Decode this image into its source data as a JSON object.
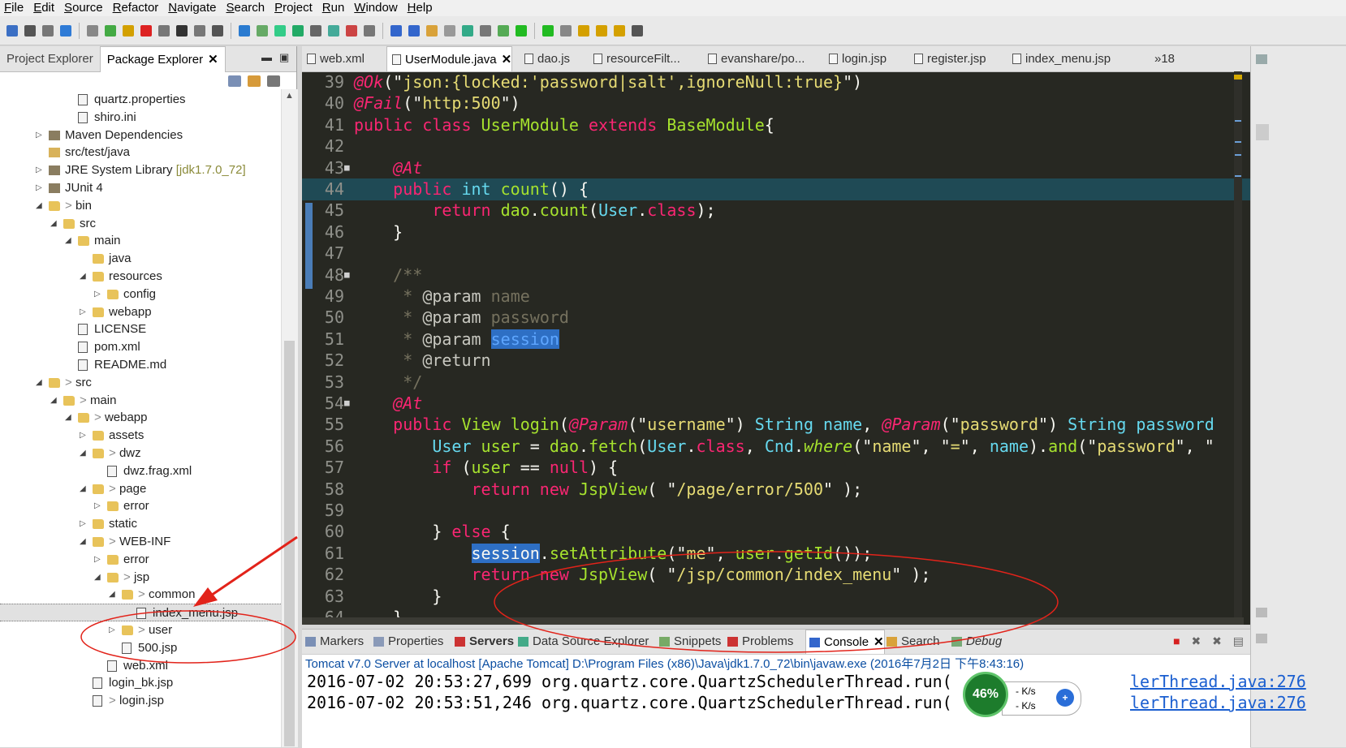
{
  "menu": [
    "File",
    "Edit",
    "Source",
    "Refactor",
    "Navigate",
    "Search",
    "Project",
    "Run",
    "Window",
    "Help"
  ],
  "left_panel": {
    "tabs": [
      {
        "label": "Project Explorer",
        "active": false
      },
      {
        "label": "Package Explorer",
        "active": true,
        "close": "✕"
      }
    ],
    "tree": [
      {
        "label": "quartz.properties",
        "indent": 3,
        "icon": "file-icon",
        "twisty": ""
      },
      {
        "label": "shiro.ini",
        "indent": 3,
        "icon": "file-icon",
        "twisty": ""
      },
      {
        "label": "Maven Dependencies",
        "indent": 1,
        "icon": "library-icon",
        "twisty": "▷"
      },
      {
        "label": "src/test/java",
        "indent": 1,
        "icon": "source-folder-icon",
        "twisty": ""
      },
      {
        "label": "JRE System Library",
        "suffix": "[jdk1.7.0_72]",
        "indent": 1,
        "icon": "library-icon",
        "twisty": "▷"
      },
      {
        "label": "JUnit 4",
        "indent": 1,
        "icon": "library-icon",
        "twisty": "▷"
      },
      {
        "label": "bin",
        "prefix": "> ",
        "indent": 1,
        "icon": "folder-icon",
        "twisty": "◢"
      },
      {
        "label": "src",
        "indent": 2,
        "icon": "folder-icon",
        "twisty": "◢"
      },
      {
        "label": "main",
        "indent": 3,
        "icon": "folder-icon",
        "twisty": "◢"
      },
      {
        "label": "java",
        "indent": 4,
        "icon": "folder-icon",
        "twisty": ""
      },
      {
        "label": "resources",
        "indent": 4,
        "icon": "folder-icon",
        "twisty": "◢"
      },
      {
        "label": "config",
        "indent": 5,
        "icon": "folder-icon",
        "twisty": "▷"
      },
      {
        "label": "webapp",
        "indent": 4,
        "icon": "folder-icon",
        "twisty": "▷"
      },
      {
        "label": "LICENSE",
        "indent": 3,
        "icon": "file-icon",
        "twisty": ""
      },
      {
        "label": "pom.xml",
        "indent": 3,
        "icon": "xml-file-icon",
        "twisty": ""
      },
      {
        "label": "README.md",
        "indent": 3,
        "icon": "file-icon",
        "twisty": ""
      },
      {
        "label": "src",
        "prefix": "> ",
        "indent": 1,
        "icon": "folder-icon",
        "twisty": "◢"
      },
      {
        "label": "main",
        "prefix": "> ",
        "indent": 2,
        "icon": "folder-icon",
        "twisty": "◢"
      },
      {
        "label": "webapp",
        "prefix": "> ",
        "indent": 3,
        "icon": "folder-icon",
        "twisty": "◢"
      },
      {
        "label": "assets",
        "indent": 4,
        "icon": "folder-icon",
        "twisty": "▷"
      },
      {
        "label": "dwz",
        "prefix": "> ",
        "indent": 4,
        "icon": "folder-icon",
        "twisty": "◢"
      },
      {
        "label": "dwz.frag.xml",
        "indent": 5,
        "icon": "xml-file-icon",
        "twisty": ""
      },
      {
        "label": "page",
        "prefix": "> ",
        "indent": 4,
        "icon": "folder-icon",
        "twisty": "◢"
      },
      {
        "label": "error",
        "indent": 5,
        "icon": "folder-icon",
        "twisty": "▷"
      },
      {
        "label": "static",
        "indent": 4,
        "icon": "folder-icon",
        "twisty": "▷"
      },
      {
        "label": "WEB-INF",
        "prefix": "> ",
        "indent": 4,
        "icon": "folder-icon",
        "twisty": "◢"
      },
      {
        "label": "error",
        "indent": 5,
        "icon": "folder-icon",
        "twisty": "▷"
      },
      {
        "label": "jsp",
        "prefix": "> ",
        "indent": 5,
        "icon": "folder-icon",
        "twisty": "◢"
      },
      {
        "label": "common",
        "prefix": "> ",
        "indent": 6,
        "icon": "folder-icon",
        "twisty": "◢"
      },
      {
        "label": "index_menu.jsp",
        "indent": 7,
        "icon": "jsp-file-icon",
        "twisty": "",
        "selected": true
      },
      {
        "label": "user",
        "prefix": "> ",
        "indent": 6,
        "icon": "folder-icon",
        "twisty": "▷"
      },
      {
        "label": "500.jsp",
        "indent": 6,
        "icon": "jsp-file-icon",
        "twisty": ""
      },
      {
        "label": "web.xml",
        "indent": 5,
        "icon": "xml-file-icon",
        "twisty": ""
      },
      {
        "label": "login_bk.jsp",
        "indent": 4,
        "icon": "jsp-file-icon",
        "twisty": ""
      },
      {
        "label": "login.jsp",
        "prefix": "> ",
        "indent": 4,
        "icon": "jsp-file-icon",
        "twisty": ""
      }
    ]
  },
  "editor": {
    "tabs": [
      {
        "label": "web.xml",
        "active": false
      },
      {
        "label": "UserModule.java",
        "active": true,
        "close": "✕"
      },
      {
        "label": "dao.js",
        "active": false
      },
      {
        "label": "resourceFilt...",
        "active": false
      },
      {
        "label": "evanshare/po...",
        "active": false
      },
      {
        "label": "login.jsp",
        "active": false
      },
      {
        "label": "register.jsp",
        "active": false
      },
      {
        "label": "index_menu.jsp",
        "active": false
      },
      {
        "label": "»18",
        "active": false
      }
    ],
    "lines": [
      {
        "n": "39",
        "tokens": [
          [
            "a",
            "@Ok"
          ],
          [
            "w",
            "(\""
          ],
          [
            "s",
            "json:{locked:'password|salt',ignoreNull:true}"
          ],
          [
            "w",
            "\")"
          ]
        ]
      },
      {
        "n": "40",
        "tokens": [
          [
            "a",
            "@Fail"
          ],
          [
            "w",
            "(\""
          ],
          [
            "s",
            "http:500"
          ],
          [
            "w",
            "\")"
          ]
        ]
      },
      {
        "n": "41",
        "tokens": [
          [
            "k",
            "public class "
          ],
          [
            "f",
            "UserModule "
          ],
          [
            "k",
            "extends "
          ],
          [
            "f",
            "BaseModule"
          ],
          [
            "w",
            "{"
          ]
        ]
      },
      {
        "n": "42",
        "tokens": []
      },
      {
        "n": "43",
        "fold": "■",
        "tokens": [
          [
            "w",
            "    "
          ],
          [
            "a",
            "@At"
          ]
        ]
      },
      {
        "n": "44",
        "hl": true,
        "tokens": [
          [
            "w",
            "    "
          ],
          [
            "k",
            "public "
          ],
          [
            "t",
            "int "
          ],
          [
            "f",
            "count"
          ],
          [
            "w",
            "() {"
          ]
        ]
      },
      {
        "n": "45",
        "tokens": [
          [
            "w",
            "        "
          ],
          [
            "k",
            "return "
          ],
          [
            "f",
            "dao"
          ],
          [
            "w",
            "."
          ],
          [
            "f",
            "count"
          ],
          [
            "w",
            "("
          ],
          [
            "t",
            "User"
          ],
          [
            "w",
            "."
          ],
          [
            "k",
            "class"
          ],
          [
            "w",
            ");"
          ]
        ]
      },
      {
        "n": "46",
        "tokens": [
          [
            "w",
            "    }"
          ]
        ]
      },
      {
        "n": "47",
        "tokens": []
      },
      {
        "n": "48",
        "fold": "■",
        "tokens": [
          [
            "w",
            "    "
          ],
          [
            "c",
            "/**"
          ]
        ]
      },
      {
        "n": "49",
        "tokens": [
          [
            "w",
            "     "
          ],
          [
            "c",
            "* "
          ],
          [
            "ct",
            "@param "
          ],
          [
            "c",
            "name"
          ]
        ]
      },
      {
        "n": "50",
        "tokens": [
          [
            "w",
            "     "
          ],
          [
            "c",
            "* "
          ],
          [
            "ct",
            "@param "
          ],
          [
            "c",
            "password"
          ]
        ]
      },
      {
        "n": "51",
        "tokens": [
          [
            "w",
            "     "
          ],
          [
            "c",
            "* "
          ],
          [
            "ct",
            "@param "
          ],
          [
            "sel",
            "session"
          ]
        ]
      },
      {
        "n": "52",
        "tokens": [
          [
            "w",
            "     "
          ],
          [
            "c",
            "* "
          ],
          [
            "ct",
            "@return"
          ]
        ]
      },
      {
        "n": "53",
        "tokens": [
          [
            "w",
            "     "
          ],
          [
            "c",
            "*/"
          ]
        ]
      },
      {
        "n": "54",
        "fold": "■",
        "tokens": [
          [
            "w",
            "    "
          ],
          [
            "a",
            "@At"
          ]
        ]
      },
      {
        "n": "55",
        "tokens": [
          [
            "w",
            "    "
          ],
          [
            "k",
            "public "
          ],
          [
            "f",
            "View "
          ],
          [
            "f",
            "login"
          ],
          [
            "w",
            "("
          ],
          [
            "a",
            "@Param"
          ],
          [
            "w",
            "(\""
          ],
          [
            "s",
            "username"
          ],
          [
            "w",
            "\") "
          ],
          [
            "t",
            "String "
          ],
          [
            "t",
            "name"
          ],
          [
            "w",
            ", "
          ],
          [
            "a",
            "@Param"
          ],
          [
            "w",
            "(\""
          ],
          [
            "s",
            "password"
          ],
          [
            "w",
            "\") "
          ],
          [
            "t",
            "String "
          ],
          [
            "t",
            "password"
          ]
        ]
      },
      {
        "n": "56",
        "tokens": [
          [
            "w",
            "        "
          ],
          [
            "t",
            "User "
          ],
          [
            "f",
            "user "
          ],
          [
            "w",
            "= "
          ],
          [
            "f",
            "dao"
          ],
          [
            "w",
            "."
          ],
          [
            "f",
            "fetch"
          ],
          [
            "w",
            "("
          ],
          [
            "t",
            "User"
          ],
          [
            "w",
            "."
          ],
          [
            "k",
            "class"
          ],
          [
            "w",
            ", "
          ],
          [
            "t",
            "Cnd"
          ],
          [
            "w",
            "."
          ],
          [
            "i",
            "where"
          ],
          [
            "w",
            "(\""
          ],
          [
            "s",
            "name"
          ],
          [
            "w",
            "\", \""
          ],
          [
            "s",
            "="
          ],
          [
            "w",
            "\", "
          ],
          [
            "t",
            "name"
          ],
          [
            "w",
            ")."
          ],
          [
            "f",
            "and"
          ],
          [
            "w",
            "(\""
          ],
          [
            "s",
            "password"
          ],
          [
            "w",
            "\", \""
          ]
        ]
      },
      {
        "n": "57",
        "tokens": [
          [
            "w",
            "        "
          ],
          [
            "k",
            "if "
          ],
          [
            "w",
            "("
          ],
          [
            "f",
            "user "
          ],
          [
            "w",
            "== "
          ],
          [
            "k",
            "null"
          ],
          [
            "w",
            ") {"
          ]
        ]
      },
      {
        "n": "58",
        "tokens": [
          [
            "w",
            "            "
          ],
          [
            "k",
            "return new "
          ],
          [
            "f",
            "JspView"
          ],
          [
            "w",
            "( \""
          ],
          [
            "s",
            "/page/error/500"
          ],
          [
            "w",
            "\" );"
          ]
        ]
      },
      {
        "n": "59",
        "tokens": []
      },
      {
        "n": "60",
        "tokens": [
          [
            "w",
            "        } "
          ],
          [
            "k",
            "else "
          ],
          [
            "w",
            "{"
          ]
        ]
      },
      {
        "n": "61",
        "tokens": [
          [
            "w",
            "            "
          ],
          [
            "sel2",
            "session"
          ],
          [
            "w",
            "."
          ],
          [
            "f",
            "setAttribute"
          ],
          [
            "w",
            "(\""
          ],
          [
            "s",
            "me"
          ],
          [
            "w",
            "\", "
          ],
          [
            "f",
            "user"
          ],
          [
            "w",
            "."
          ],
          [
            "f",
            "getId"
          ],
          [
            "w",
            "());"
          ]
        ]
      },
      {
        "n": "62",
        "tokens": [
          [
            "w",
            "            "
          ],
          [
            "k",
            "return new "
          ],
          [
            "f",
            "JspView"
          ],
          [
            "w",
            "( \""
          ],
          [
            "s",
            "/jsp/common/index_menu"
          ],
          [
            "w",
            "\" );"
          ]
        ]
      },
      {
        "n": "63",
        "tokens": [
          [
            "w",
            "        }"
          ]
        ]
      },
      {
        "n": "64",
        "tokens": [
          [
            "w",
            "    }"
          ]
        ]
      }
    ]
  },
  "console": {
    "tabs": [
      {
        "label": "Markers",
        "icon": "markers-icon"
      },
      {
        "label": "Properties",
        "icon": "properties-icon"
      },
      {
        "label": "Servers",
        "icon": "servers-icon",
        "bold": true
      },
      {
        "label": "Data Source Explorer",
        "icon": "datasource-icon"
      },
      {
        "label": "Snippets",
        "icon": "snippets-icon"
      },
      {
        "label": "Problems",
        "icon": "problems-icon"
      },
      {
        "label": "Console",
        "icon": "console-icon",
        "active": true,
        "close": "✕"
      },
      {
        "label": "Search",
        "icon": "search-icon"
      },
      {
        "label": "Debug",
        "icon": "debug-icon",
        "italic": true
      }
    ],
    "description": "Tomcat v7.0 Server at localhost [Apache Tomcat] D:\\Program Files (x86)\\Java\\jdk1.7.0_72\\bin\\javaw.exe (2016年7月2日 下午8:43:16)",
    "lines": [
      {
        "text": "2016-07-02 20:53:27,699 org.quartz.core.QuartzSchedulerThread.run(",
        "link": "lerThread.java:276"
      },
      {
        "text": "2016-07-02 20:53:51,246 org.quartz.core.QuartzSchedulerThread.run(",
        "link": "lerThread.java:276"
      }
    ]
  },
  "net_widget": {
    "percent": "46%",
    "up": "- K/s",
    "down": "- K/s",
    "plus": "+"
  },
  "colors": {
    "editor_bg": "#272822",
    "keyword": "#f92672",
    "type": "#66d9ef",
    "string": "#e6db74",
    "function": "#a6e22e",
    "annotation_red": "#e2231a"
  }
}
